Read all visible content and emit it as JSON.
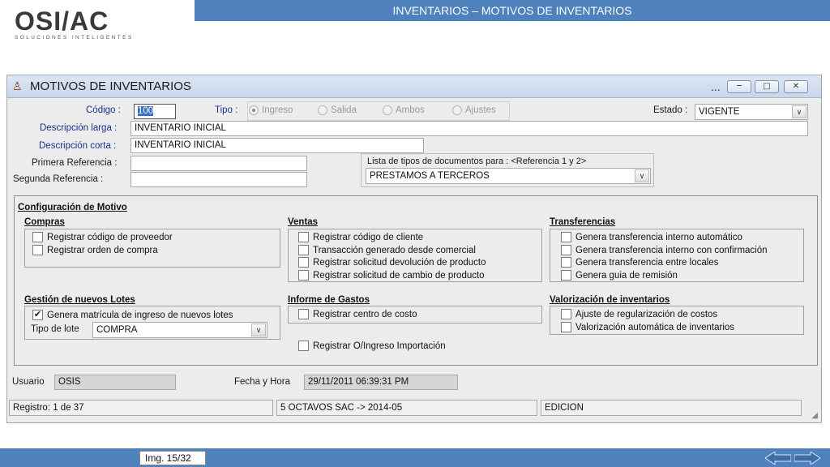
{
  "header": {
    "logo_brand": "OSI/AC",
    "logo_tagline": "SOLUCIONES INTELIGENTES",
    "slide_title": "INVENTARIOS – MOTIVOS DE INVENTARIOS"
  },
  "window": {
    "title": "MOTIVOS DE INVENTARIOS",
    "dots": "...",
    "icon": "person-icon"
  },
  "form": {
    "codigo_label": "Código :",
    "codigo_value": "100",
    "tipo_label": "Tipo :",
    "tipo_options": [
      "Ingreso",
      "Salida",
      "Ambos",
      "Ajustes"
    ],
    "tipo_selected": "Ingreso",
    "estado_label": "Estado :",
    "estado_value": "VIGENTE",
    "desc_larga_label": "Descripción larga :",
    "desc_larga_value": "INVENTARIO INICIAL",
    "desc_corta_label": "Descripción corta :",
    "desc_corta_value": "INVENTARIO INICIAL",
    "primera_ref_label": "Primera Referencia :",
    "primera_ref_value": "",
    "segunda_ref_label": "Segunda Referencia :",
    "segunda_ref_value": "",
    "lista_tipos_label": "Lista de tipos de documentos para : <Referencia 1 y 2>",
    "lista_tipos_value": "PRESTAMOS A TERCEROS"
  },
  "config": {
    "title": "Configuración de Motivo",
    "compras": {
      "title": "Compras",
      "items": [
        {
          "label": "Registrar código de proveedor",
          "checked": false
        },
        {
          "label": "Registrar orden de compra",
          "checked": false
        }
      ]
    },
    "ventas": {
      "title": "Ventas",
      "items": [
        {
          "label": "Registrar código de cliente",
          "checked": false
        },
        {
          "label": "Transacción generado desde comercial",
          "checked": false
        },
        {
          "label": "Registrar solicitud devolución de producto",
          "checked": false
        },
        {
          "label": "Registrar solicitud de cambio de producto",
          "checked": false
        }
      ]
    },
    "transferencias": {
      "title": "Transferencias",
      "items": [
        {
          "label": "Genera transferencia interno automático",
          "checked": false
        },
        {
          "label": "Genera transferencia interno con confirmación",
          "checked": false
        },
        {
          "label": "Genera transferencia entre locales",
          "checked": false
        },
        {
          "label": "Genera guia de remisión",
          "checked": false
        }
      ]
    },
    "lotes": {
      "title": "Gestión de nuevos Lotes",
      "item": {
        "label": "Genera matrícula de ingreso de nuevos lotes",
        "checked": true
      },
      "tipo_lote_label": "Tipo de lote",
      "tipo_lote_value": "COMPRA"
    },
    "gastos": {
      "title": "Informe de Gastos",
      "item": {
        "label": "Registrar centro de costo",
        "checked": false
      }
    },
    "valorizacion": {
      "title": "Valorización de inventarios",
      "items": [
        {
          "label": "Ajuste de regularización de costos",
          "checked": false
        },
        {
          "label": "Valorización automática de inventarios",
          "checked": false
        }
      ]
    },
    "importacion": {
      "label": "Registrar O/Ingreso Importación",
      "checked": false
    }
  },
  "audit": {
    "usuario_label": "Usuario",
    "usuario_value": "OSIS",
    "fecha_label": "Fecha y Hora",
    "fecha_value": "29/11/2011 06:39:31 PM"
  },
  "statusbar": {
    "registro": "Registro: 1 de 37",
    "empresa": "5 OCTAVOS SAC -> 2014-05",
    "modo": "EDICION"
  },
  "footer": {
    "img_label": "Img. 15/32"
  },
  "colors": {
    "accent_blue": "#4f81bd",
    "window_bg": "#ececec"
  }
}
